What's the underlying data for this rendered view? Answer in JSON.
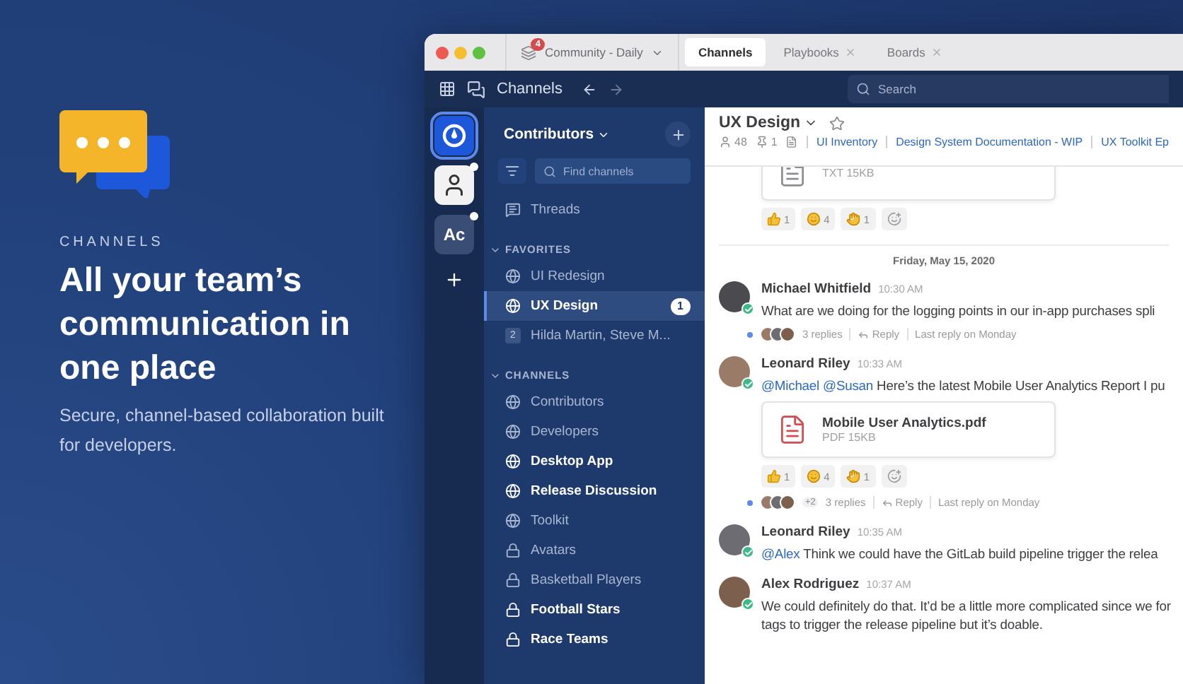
{
  "hero": {
    "eyebrow": "CHANNELS",
    "headline": "All your team’s communication in one place",
    "subtitle": "Secure, channel-based collaboration built for developers."
  },
  "window": {
    "workspace": {
      "label": "Community - Daily",
      "badge": "4"
    },
    "tabs": [
      {
        "label": "Channels",
        "selected": true,
        "closable": false
      },
      {
        "label": "Playbooks",
        "selected": false,
        "closable": true
      },
      {
        "label": "Boards",
        "selected": false,
        "closable": true
      }
    ]
  },
  "header": {
    "title": "Channels",
    "search": {
      "placeholder": "Search"
    }
  },
  "teams": [
    {
      "kind": "logo",
      "selected": true,
      "unread": false
    },
    {
      "kind": "avatar",
      "selected": false,
      "unread": true
    },
    {
      "kind": "initials",
      "label": "Ac",
      "selected": false,
      "unread": true
    }
  ],
  "sidebar": {
    "team_name": "Contributors",
    "filter": {
      "placeholder": "Find channels"
    },
    "threads": "Threads",
    "sections": [
      {
        "title": "FAVORITES",
        "expanded": true,
        "items": [
          {
            "kind": "public",
            "label": "UI Redesign",
            "selected": false,
            "unread": false
          },
          {
            "kind": "public",
            "label": "UX Design",
            "selected": true,
            "unread": true,
            "mentions": "1"
          },
          {
            "kind": "group",
            "label": "Hilda Martin, Steve M...",
            "count": "2",
            "selected": false,
            "unread": false
          }
        ]
      },
      {
        "title": "CHANNELS",
        "expanded": true,
        "items": [
          {
            "kind": "public",
            "label": "Contributors",
            "selected": false,
            "unread": false
          },
          {
            "kind": "public",
            "label": "Developers",
            "selected": false,
            "unread": false
          },
          {
            "kind": "public",
            "label": "Desktop App",
            "selected": false,
            "unread": true
          },
          {
            "kind": "public",
            "label": "Release Discussion",
            "selected": false,
            "unread": true
          },
          {
            "kind": "public",
            "label": "Toolkit",
            "selected": false,
            "unread": false
          },
          {
            "kind": "private",
            "label": "Avatars",
            "selected": false,
            "unread": false
          },
          {
            "kind": "private",
            "label": "Basketball Players",
            "selected": false,
            "unread": false
          },
          {
            "kind": "private",
            "label": "Football Stars",
            "selected": false,
            "unread": true
          },
          {
            "kind": "private",
            "label": "Race Teams",
            "selected": false,
            "unread": true
          }
        ]
      }
    ]
  },
  "channel": {
    "name": "UX Design",
    "members": "48",
    "pinned": "1",
    "links": [
      "UI Inventory",
      "Design System Documentation - WIP",
      "UX Toolkit Ep"
    ]
  },
  "fragment": {
    "attachment": {
      "kind": "txt",
      "meta": "TXT 15KB"
    },
    "reactions": [
      {
        "kind": "thumbs",
        "count": "1"
      },
      {
        "kind": "smile",
        "count": "4"
      },
      {
        "kind": "hands",
        "count": "1"
      }
    ]
  },
  "date_divider": "Friday, May 15, 2020",
  "posts": [
    {
      "author": "Michael Whitfield",
      "time": "10:30 AM",
      "online": true,
      "text": "What are we doing for the logging points in our in-app purchases spli",
      "thread": {
        "replies": "3 replies",
        "reply": "Reply",
        "last": "Last reply on Monday"
      }
    },
    {
      "author": "Leonard Riley",
      "time": "10:33 AM",
      "online": true,
      "mentions": "@Michael @Susan",
      "text": "Here’s the latest Mobile User Analytics Report I pu",
      "attachment": {
        "kind": "pdf",
        "name": "Mobile User Analytics.pdf",
        "meta": "PDF 15KB"
      },
      "reactions": [
        {
          "kind": "thumbs",
          "count": "1"
        },
        {
          "kind": "smile",
          "count": "4"
        },
        {
          "kind": "hands",
          "count": "1"
        }
      ],
      "thread": {
        "extra": "+2",
        "replies": "3 replies",
        "reply": "Reply",
        "last": "Last reply on Monday"
      }
    },
    {
      "author": "Leonard Riley",
      "time": "10:35 AM",
      "online": true,
      "mentions": "@Alex",
      "text": "Think we could have the GitLab build pipeline trigger the relea"
    },
    {
      "author": "Alex Rodriguez",
      "time": "10:37 AM",
      "online": true,
      "text": "We could definitely do that. It’d be a little more complicated since we for tags to trigger the release pipeline but it’s doable."
    }
  ]
}
